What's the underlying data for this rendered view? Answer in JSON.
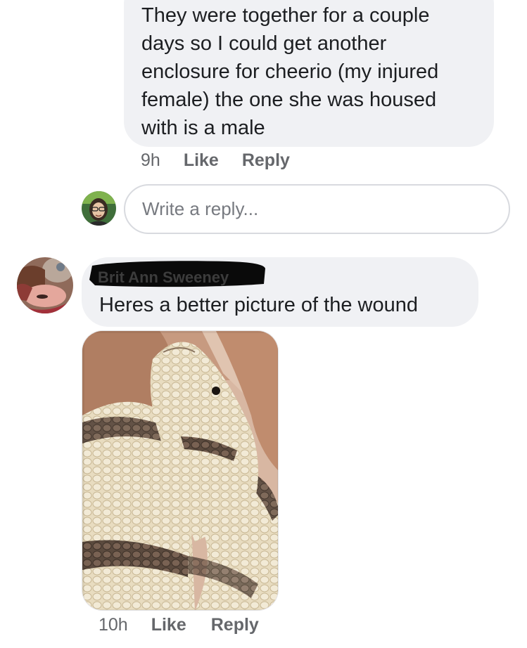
{
  "comment_1": {
    "text": "They were together for a  couple\ndays so I could get another\nenclosure for cheerio (my injured\nfemale) the one she was housed\nwith is a male",
    "time": "9h",
    "like_label": "Like",
    "reply_label": "Reply"
  },
  "reply_box": {
    "placeholder": "Write a reply..."
  },
  "comment_2": {
    "author": "Brit Ann Sweeney",
    "text": "Heres a better picture of the wound",
    "time": "10h",
    "like_label": "Like",
    "reply_label": "Reply"
  },
  "colors": {
    "bubble_bg": "#f0f1f4",
    "meta_text": "#65676b",
    "input_border": "#d8dadf"
  }
}
